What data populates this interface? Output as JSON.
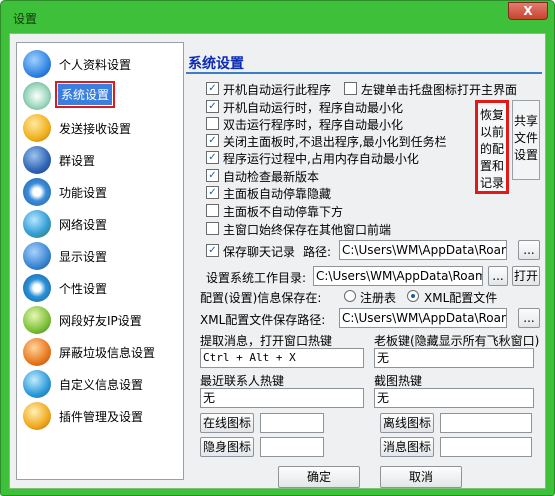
{
  "window": {
    "title": "设置",
    "close_glyph": "X"
  },
  "sidebar": {
    "items": [
      {
        "label": "个人资料设置",
        "icon": "profile-icon",
        "color": "#2a7ee0"
      },
      {
        "label": "系统设置",
        "icon": "system-icon",
        "color": "#7fbf9c",
        "selected": true
      },
      {
        "label": "发送接收设置",
        "icon": "send-receive-icon",
        "color": "#f0b01e"
      },
      {
        "label": "群设置",
        "icon": "group-icon",
        "color": "#2f64b4"
      },
      {
        "label": "功能设置",
        "icon": "function-icon",
        "color": "#3b8ed8"
      },
      {
        "label": "网络设置",
        "icon": "network-icon",
        "color": "#37a0d8"
      },
      {
        "label": "显示设置",
        "icon": "display-icon",
        "color": "#3a85d0"
      },
      {
        "label": "个性设置",
        "icon": "personalize-icon",
        "color": "#2c92d8"
      },
      {
        "label": "网段好友IP设置",
        "icon": "ip-segment-icon",
        "color": "#7cc03a"
      },
      {
        "label": "屏蔽垃圾信息设置",
        "icon": "block-spam-icon",
        "color": "#e8781e"
      },
      {
        "label": "自定义信息设置",
        "icon": "custom-info-icon",
        "color": "#2b9ad8"
      },
      {
        "label": "插件管理及设置",
        "icon": "plugin-icon",
        "color": "#f0a81e"
      }
    ]
  },
  "main": {
    "heading": "系统设置",
    "options": {
      "startup_run": "开机自动运行此程序",
      "left_click_tray": "左键单击托盘图标打开主界面",
      "startup_minimize": "开机自动运行时，程序自动最小化",
      "double_click_minimize": "双击运行程序时，程序自动最小化",
      "close_to_tray": "关闭主面板时,不退出程序,最小化到任务栏",
      "reduce_memory": "程序运行过程中,占用内存自动最小化",
      "check_update": "自动检查最新版本",
      "auto_dock": "主面板自动停靠隐藏",
      "no_dock_bottom": "主面板不自动停靠下方",
      "always_top": "主窗口始终保存在其他窗口前端",
      "save_chat": "保存聊天记录"
    },
    "restore_button": "恢复以前的配置和记录",
    "share_button": "共享文件设置",
    "path_label": "路径:",
    "chat_path": "C:\\Users\\WM\\AppData\\Roaming",
    "browse_glyph": "...",
    "workdir_label": "设置系统工作目录:",
    "workdir_path": "C:\\Users\\WM\\AppData\\Roaming",
    "open_button": "打开",
    "config_save_label": "配置(设置)信息保存在:",
    "radio_registry": "注册表",
    "radio_xml": "XML配置文件",
    "xml_path_label": "XML配置文件保存路径:",
    "xml_path": "C:\\Users\\WM\\AppData\\Roaming",
    "hotkey_extract_label": "提取消息，打开窗口热键",
    "hotkey_extract_value": "Ctrl + Alt + X",
    "boss_key_label": "老板键(隐藏显示所有飞秋窗口)",
    "boss_key_value": "无",
    "recent_contact_label": "最近联系人热键",
    "recent_contact_value": "无",
    "screenshot_label": "截图热键",
    "screenshot_value": "无",
    "online_icon": "在线图标",
    "offline_icon": "离线图标",
    "hidden_icon": "隐身图标",
    "message_icon": "消息图标",
    "ok_button": "确定",
    "cancel_button": "取消"
  }
}
